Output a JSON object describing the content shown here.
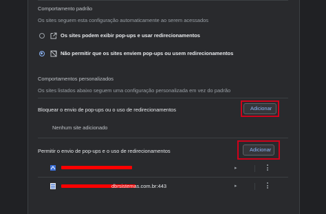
{
  "default_behavior": {
    "title": "Comportamento padrão",
    "subtitle": "Os sites seguem esta configuração automaticamente ao serem acessados",
    "options": [
      {
        "label": "Os sites podem exibir pop-ups e usar redirecionamentos",
        "icon": "open-in-new-icon",
        "selected": false
      },
      {
        "label": "Não permitir que os sites enviem pop-ups ou usem redirecionamentos",
        "icon": "popup-blocked-icon",
        "selected": true
      }
    ]
  },
  "custom_behavior": {
    "title": "Comportamentos personalizados",
    "subtitle": "Os sites listados abaixo seguem uma configuração personalizada em vez do padrão",
    "block": {
      "label": "Bloquear o envio de pop-ups ou o uso de redirecionamentos",
      "add_button": "Adicionar",
      "empty_text": "Nenhum site adicionado"
    },
    "allow": {
      "label": "Permitir o envio de pop-ups e o uso de redirecionamentos",
      "add_button": "Adicionar",
      "sites": [
        {
          "visible_text": "",
          "redacted": true
        },
        {
          "visible_text": "dbrsistemas.com.br:443",
          "redacted": true
        }
      ]
    }
  },
  "colors": {
    "accent": "#8ab4f8",
    "highlight_box": "#d0021b",
    "redaction": "#ff0000",
    "background": "#202124",
    "panel": "#292a2d"
  }
}
